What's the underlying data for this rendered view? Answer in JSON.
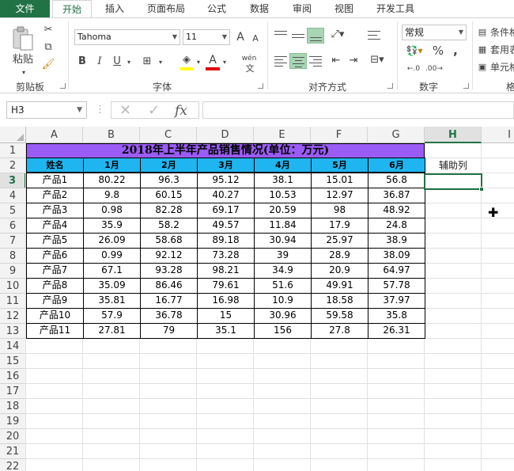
{
  "tabs": [
    "文件",
    "开始",
    "插入",
    "页面布局",
    "公式",
    "数据",
    "审阅",
    "视图",
    "开发工具"
  ],
  "active_tab": "开始",
  "ribbon": {
    "clipboard": {
      "label": "剪贴板",
      "paste": "粘贴"
    },
    "font": {
      "label": "字体",
      "name": "Tahoma",
      "size": "11",
      "bold": "B",
      "italic": "I",
      "underline": "U",
      "grow": "A",
      "shrink": "A",
      "color_letter": "A",
      "phonetic": "wén"
    },
    "alignment": {
      "label": "对齐方式"
    },
    "number": {
      "label": "数字",
      "format": "常规",
      "percent": "%",
      "comma": ","
    },
    "styles": {
      "cond": "条件格",
      "table": "套用表",
      "cell": "单元格"
    },
    "cells_label": "格"
  },
  "formula_bar": {
    "name_box": "H3",
    "fx": "fx",
    "cancel": "✕",
    "enter": "✓",
    "value": ""
  },
  "grid": {
    "columns": [
      "A",
      "B",
      "C",
      "D",
      "E",
      "F",
      "G",
      "H",
      "I"
    ],
    "selected_column": "H",
    "rows": [
      "1",
      "2",
      "3",
      "4",
      "5",
      "6",
      "7",
      "8",
      "9",
      "10",
      "11",
      "12",
      "13",
      "14",
      "15",
      "16",
      "17",
      "18",
      "19",
      "20",
      "21",
      "22"
    ],
    "selected_row": "3",
    "title": "2018年上半年产品销售情况(单位：万元)",
    "headers": [
      "姓名",
      "1月",
      "2月",
      "3月",
      "4月",
      "5月",
      "6月"
    ],
    "helper_label": "辅助列",
    "data": [
      [
        "产品1",
        "80.22",
        "96.3",
        "95.12",
        "38.1",
        "15.01",
        "56.8"
      ],
      [
        "产品2",
        "9.8",
        "60.15",
        "40.27",
        "10.53",
        "12.97",
        "36.87"
      ],
      [
        "产品3",
        "0.98",
        "82.28",
        "69.17",
        "20.59",
        "98",
        "48.92"
      ],
      [
        "产品4",
        "35.9",
        "58.2",
        "49.57",
        "11.84",
        "17.9",
        "24.8"
      ],
      [
        "产品5",
        "26.09",
        "58.68",
        "89.18",
        "30.94",
        "25.97",
        "38.9"
      ],
      [
        "产品6",
        "0.99",
        "92.12",
        "73.28",
        "39",
        "28.9",
        "38.09"
      ],
      [
        "产品7",
        "67.1",
        "93.28",
        "98.21",
        "34.9",
        "20.9",
        "64.97"
      ],
      [
        "产品8",
        "35.09",
        "86.46",
        "79.61",
        "51.6",
        "49.91",
        "57.78"
      ],
      [
        "产品9",
        "35.81",
        "16.77",
        "16.98",
        "10.9",
        "18.58",
        "37.97"
      ],
      [
        "产品10",
        "57.9",
        "36.78",
        "15",
        "30.96",
        "59.58",
        "35.8"
      ],
      [
        "产品11",
        "27.81",
        "79",
        "35.1",
        "156",
        "27.8",
        "26.31"
      ]
    ]
  },
  "colors": {
    "accent": "#217346",
    "title_fill": "#9a5cf5",
    "header_fill": "#1fb5f0",
    "font_color_bar": "#e00000"
  }
}
